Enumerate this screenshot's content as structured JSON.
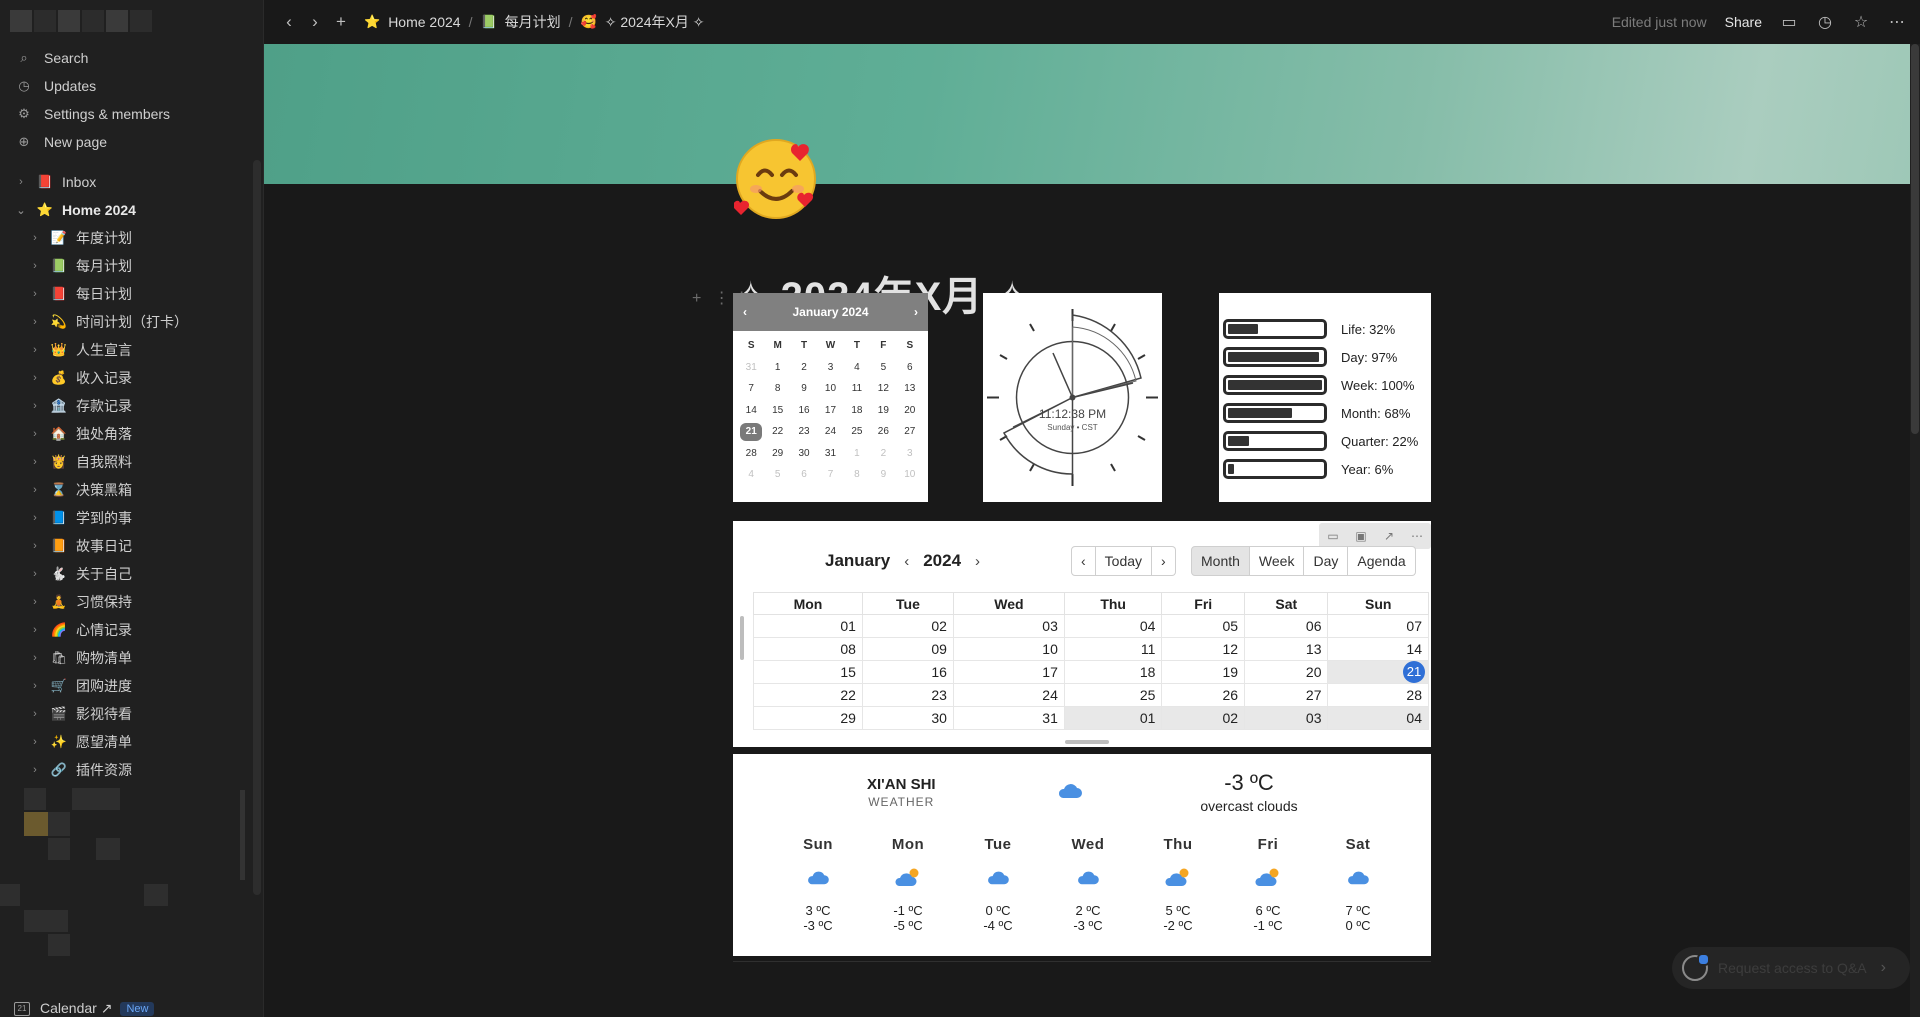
{
  "sidebar": {
    "top_items": [
      {
        "label": "Search",
        "icon": "search-icon"
      },
      {
        "label": "Updates",
        "icon": "clock-icon"
      },
      {
        "label": "Settings & members",
        "icon": "gear-icon"
      },
      {
        "label": "New page",
        "icon": "plus-circle-icon"
      }
    ],
    "inbox": {
      "label": "Inbox",
      "emoji": "📕"
    },
    "home": {
      "label": "Home 2024",
      "emoji": "⭐"
    },
    "children": [
      {
        "label": "年度计划",
        "emoji": "📝"
      },
      {
        "label": "每月计划",
        "emoji": "📗"
      },
      {
        "label": "每日计划",
        "emoji": "📕"
      },
      {
        "label": "时间计划（打卡）",
        "emoji": "💫"
      },
      {
        "label": "人生宣言",
        "emoji": "👑"
      },
      {
        "label": "收入记录",
        "emoji": "💰"
      },
      {
        "label": "存款记录",
        "emoji": "🏦"
      },
      {
        "label": "独处角落",
        "emoji": "🏠"
      },
      {
        "label": "自我照料",
        "emoji": "👸"
      },
      {
        "label": "决策黑箱",
        "emoji": "⌛"
      },
      {
        "label": "学到的事",
        "emoji": "📘"
      },
      {
        "label": "故事日记",
        "emoji": "📙"
      },
      {
        "label": "关于自己",
        "emoji": "🐇"
      },
      {
        "label": "习惯保持",
        "emoji": "🧘"
      },
      {
        "label": "心情记录",
        "emoji": "🌈"
      },
      {
        "label": "购物清单",
        "emoji": "🛍"
      },
      {
        "label": "团购进度",
        "emoji": "🛒"
      },
      {
        "label": "影视待看",
        "emoji": "🎬"
      },
      {
        "label": "愿望清单",
        "emoji": "✨"
      },
      {
        "label": "插件资源",
        "emoji": "🔗"
      }
    ],
    "calendar": {
      "label": "Calendar ↗",
      "badge": "New",
      "icon_text": "21"
    }
  },
  "topbar": {
    "breadcrumbs": [
      {
        "label": "Home 2024",
        "emoji": "⭐"
      },
      {
        "label": "每月计划",
        "emoji": "📗"
      },
      {
        "label": "✧ 2024年X月 ✧",
        "emoji": "🥰"
      }
    ],
    "edited": "Edited just now",
    "share": "Share"
  },
  "page": {
    "title": "✧ 2024年X月 ✧",
    "icon": "smiling-face-with-hearts"
  },
  "mini_calendar": {
    "month_label": "January 2024",
    "day_names": [
      "S",
      "M",
      "T",
      "W",
      "T",
      "F",
      "S"
    ],
    "weeks": [
      [
        "31",
        "1",
        "2",
        "3",
        "4",
        "5",
        "6"
      ],
      [
        "7",
        "8",
        "9",
        "10",
        "11",
        "12",
        "13"
      ],
      [
        "14",
        "15",
        "16",
        "17",
        "18",
        "19",
        "20"
      ],
      [
        "21",
        "22",
        "23",
        "24",
        "25",
        "26",
        "27"
      ],
      [
        "28",
        "29",
        "30",
        "31",
        "1",
        "2",
        "3"
      ],
      [
        "4",
        "5",
        "6",
        "7",
        "8",
        "9",
        "10"
      ]
    ],
    "today": "21"
  },
  "clock": {
    "time": "11:12:38 PM",
    "date": "Sunday • CST"
  },
  "progress": [
    {
      "label": "Life: 32%",
      "value": 0.32
    },
    {
      "label": "Day: 97%",
      "value": 0.97
    },
    {
      "label": "Week: 100%",
      "value": 1.0
    },
    {
      "label": "Month: 68%",
      "value": 0.68
    },
    {
      "label": "Quarter: 22%",
      "value": 0.22
    },
    {
      "label": "Year: 6%",
      "value": 0.06
    }
  ],
  "big_calendar": {
    "month": "January",
    "year": "2024",
    "today_btn": "Today",
    "views": [
      "Month",
      "Week",
      "Day",
      "Agenda"
    ],
    "selected_view": "Month",
    "headers": [
      "Mon",
      "Tue",
      "Wed",
      "Thu",
      "Fri",
      "Sat",
      "Sun"
    ],
    "weeks": [
      [
        "01",
        "02",
        "03",
        "04",
        "05",
        "06",
        "07"
      ],
      [
        "08",
        "09",
        "10",
        "11",
        "12",
        "13",
        "14"
      ],
      [
        "15",
        "16",
        "17",
        "18",
        "19",
        "20",
        "21"
      ],
      [
        "22",
        "23",
        "24",
        "25",
        "26",
        "27",
        "28"
      ],
      [
        "29",
        "30",
        "31",
        "01",
        "02",
        "03",
        "04"
      ]
    ],
    "today": "21"
  },
  "weather": {
    "city": "XI'AN SHI",
    "sub": "WEATHER",
    "temp": "-3 ºC",
    "desc": "overcast clouds",
    "days": [
      {
        "name": "Sun",
        "hi": "3 ºC",
        "lo": "-3 ºC",
        "icon": "cloud"
      },
      {
        "name": "Mon",
        "hi": "-1 ºC",
        "lo": "-5 ºC",
        "icon": "cloud-sun"
      },
      {
        "name": "Tue",
        "hi": "0 ºC",
        "lo": "-4 ºC",
        "icon": "cloud"
      },
      {
        "name": "Wed",
        "hi": "2 ºC",
        "lo": "-3 ºC",
        "icon": "cloud"
      },
      {
        "name": "Thu",
        "hi": "5 ºC",
        "lo": "-2 ºC",
        "icon": "cloud-sun"
      },
      {
        "name": "Fri",
        "hi": "6 ºC",
        "lo": "-1 ºC",
        "icon": "cloud-sun"
      },
      {
        "name": "Sat",
        "hi": "7 ºC",
        "lo": "0 ºC",
        "icon": "cloud"
      }
    ]
  },
  "qa_button": "Request access to Q&A",
  "colors": {
    "accent_blue": "#2f6fd6",
    "cover_green": "#5fae96",
    "background": "#191919"
  }
}
